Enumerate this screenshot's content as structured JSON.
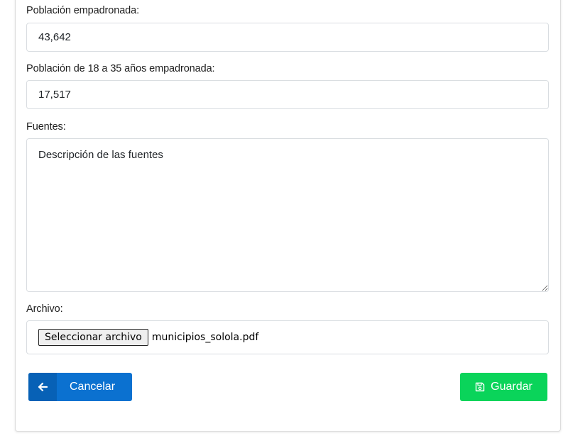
{
  "form": {
    "poblacion_label": "Población empadronada:",
    "poblacion_value": "43,642",
    "jovenes_label": "Población de 18 a 35 años empadronada:",
    "jovenes_value": "17,517",
    "fuentes_label": "Fuentes:",
    "fuentes_placeholder": "Descripción de las fuentes",
    "archivo_label": "Archivo:",
    "archivo_button": "Seleccionar archivo",
    "archivo_filename": "municipios_solola.pdf"
  },
  "actions": {
    "cancel_label": "Cancelar",
    "cancel_icon": "arrow-left-icon",
    "save_label": "Guardar",
    "save_icon": "save-icon"
  },
  "colors": {
    "cancel": "#0b71d0",
    "save": "#0ad45a"
  }
}
